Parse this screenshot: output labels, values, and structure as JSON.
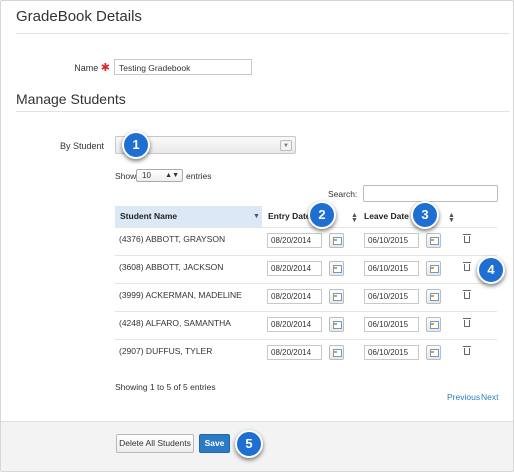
{
  "colors": {
    "accent": "#2a7ac6",
    "required": "#e0262b",
    "callout": "#1f6fd2",
    "sorted_header": "#dbe9f6",
    "link": "#2a80c6"
  },
  "gradebook": {
    "title": "GradeBook Details",
    "name_label": "Name",
    "name_value": "Testing Gradebook"
  },
  "students": {
    "title": "Manage Students",
    "by_student_label": "By Student",
    "by_student_value": "",
    "show_label": "Show",
    "entries_value": "10",
    "entries_label": "entries",
    "search_label": "Search:",
    "search_value": "",
    "columns": {
      "name": "Student Name",
      "entry": "Entry Date",
      "leave": "Leave Date"
    },
    "rows": [
      {
        "name": "(4376) ABBOTT, GRAYSON",
        "entry": "08/20/2014",
        "leave": "06/10/2015"
      },
      {
        "name": "(3608) ABBOTT, JACKSON",
        "entry": "08/20/2014",
        "leave": "06/10/2015"
      },
      {
        "name": "(3999) ACKERMAN, MADELINE",
        "entry": "08/20/2014",
        "leave": "06/10/2015"
      },
      {
        "name": "(4248) ALFARO, SAMANTHA",
        "entry": "08/20/2014",
        "leave": "06/10/2015"
      },
      {
        "name": "(2907) DUFFUS, TYLER",
        "entry": "08/20/2014",
        "leave": "06/10/2015"
      }
    ],
    "info": "Showing 1 to 5 of 5 entries",
    "pager": {
      "previous": "Previous",
      "next": "Next"
    }
  },
  "footer": {
    "delete_all": "Delete All Students",
    "save": "Save"
  },
  "callouts": [
    "1",
    "2",
    "3",
    "4",
    "5"
  ]
}
